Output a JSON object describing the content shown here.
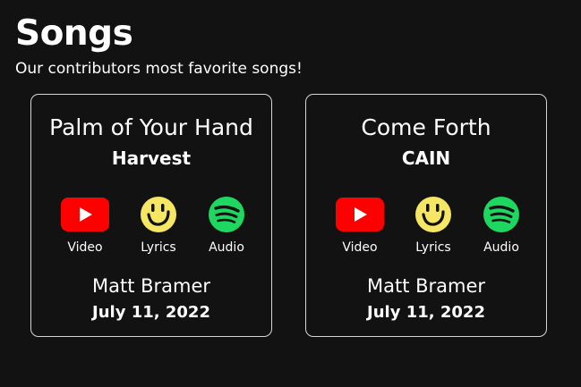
{
  "header": {
    "title": "Songs",
    "subtitle": "Our contributors most favorite songs!"
  },
  "colors": {
    "background": "#121212",
    "youtube": "#ff0000",
    "lyrics": "#f5e663",
    "spotify": "#1ed760"
  },
  "cards": [
    {
      "song": "Palm of Your Hand",
      "artist": "Harvest",
      "links": {
        "video": {
          "label": "Video",
          "icon": "youtube-icon"
        },
        "lyrics": {
          "label": "Lyrics",
          "icon": "lyrics-smiley-icon"
        },
        "audio": {
          "label": "Audio",
          "icon": "spotify-icon"
        }
      },
      "contributor": "Matt Bramer",
      "date": "July 11, 2022"
    },
    {
      "song": "Come Forth",
      "artist": "CAIN",
      "links": {
        "video": {
          "label": "Video",
          "icon": "youtube-icon"
        },
        "lyrics": {
          "label": "Lyrics",
          "icon": "lyrics-smiley-icon"
        },
        "audio": {
          "label": "Audio",
          "icon": "spotify-icon"
        }
      },
      "contributor": "Matt Bramer",
      "date": "July 11, 2022"
    }
  ]
}
